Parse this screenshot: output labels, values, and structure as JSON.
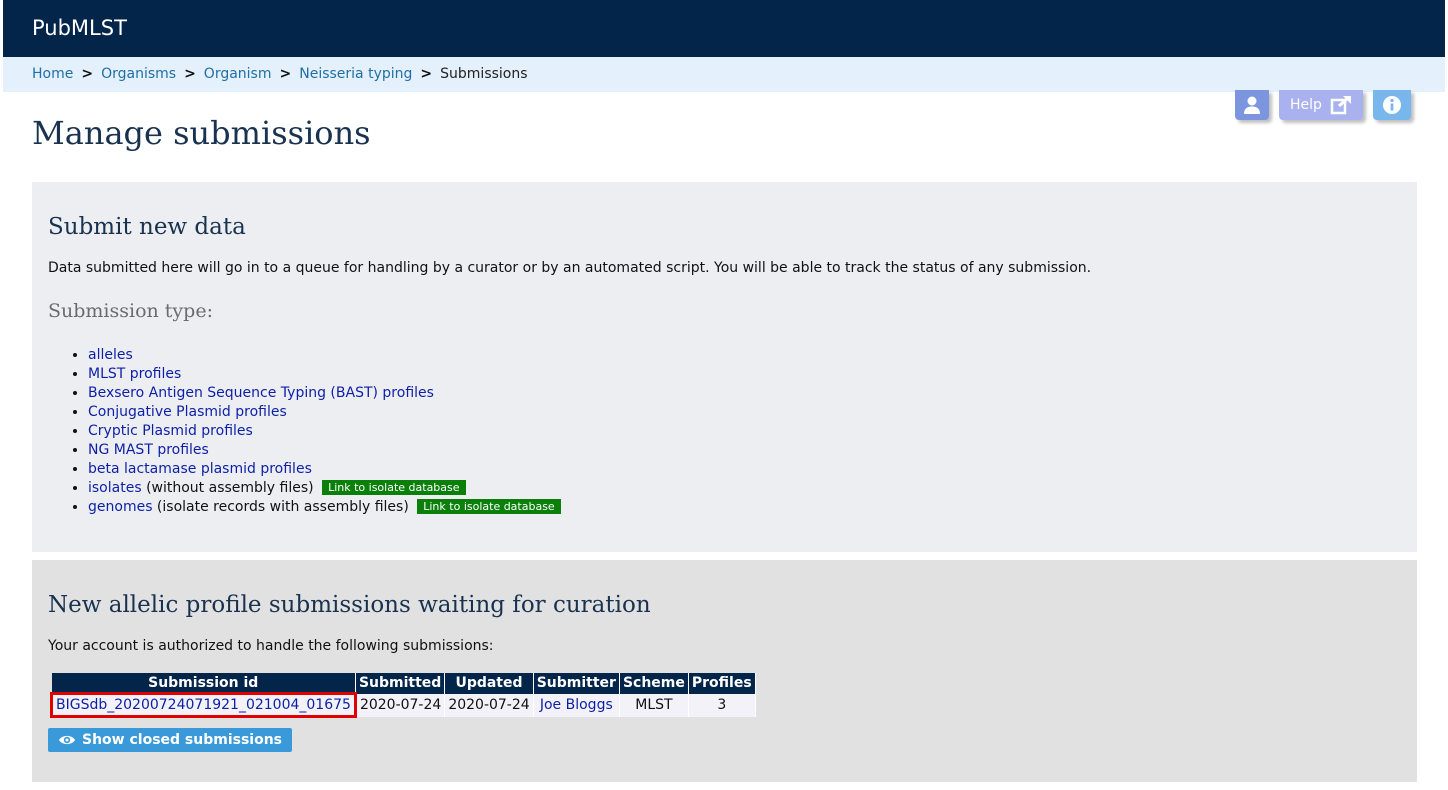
{
  "header": {
    "title": "PubMLST"
  },
  "breadcrumb": {
    "items": [
      "Home",
      "Organisms",
      "Organism",
      "Neisseria typing"
    ],
    "separator": ">",
    "current": "Submissions"
  },
  "toolbar": {
    "help_label": "Help"
  },
  "page": {
    "title": "Manage submissions"
  },
  "submit_section": {
    "heading": "Submit new data",
    "description": "Data submitted here will go in to a queue for handling by a curator or by an automated script. You will be able to track the status of any submission.",
    "type_heading": "Submission type:",
    "types": [
      {
        "label": "alleles",
        "suffix": ""
      },
      {
        "label": "MLST profiles",
        "suffix": ""
      },
      {
        "label": "Bexsero Antigen Sequence Typing (BAST) profiles",
        "suffix": ""
      },
      {
        "label": "Conjugative Plasmid profiles",
        "suffix": ""
      },
      {
        "label": "Cryptic Plasmid profiles",
        "suffix": ""
      },
      {
        "label": "NG MAST profiles",
        "suffix": ""
      },
      {
        "label": "beta lactamase plasmid profiles",
        "suffix": ""
      },
      {
        "label": "isolates",
        "suffix": " (without assembly files)",
        "badge": "Link to isolate database"
      },
      {
        "label": "genomes",
        "suffix": " (isolate records with assembly files)",
        "badge": "Link to isolate database"
      }
    ]
  },
  "pending_section": {
    "heading": "New allelic profile submissions waiting for curation",
    "description": "Your account is authorized to handle the following submissions:",
    "columns": [
      "Submission id",
      "Submitted",
      "Updated",
      "Submitter",
      "Scheme",
      "Profiles"
    ],
    "rows": [
      {
        "submission_id": "BIGSdb_20200724071921_021004_01675",
        "submitted": "2020-07-24",
        "updated": "2020-07-24",
        "submitter": "Joe Bloggs",
        "scheme": "MLST",
        "profiles": "3"
      }
    ],
    "show_closed_label": "Show closed submissions"
  },
  "icons": [
    "user-icon",
    "external-link-icon",
    "info-icon",
    "eye-icon"
  ],
  "colors": {
    "header": "#03254a",
    "badge_green": "#0a800a",
    "highlight_red": "#e00000"
  }
}
